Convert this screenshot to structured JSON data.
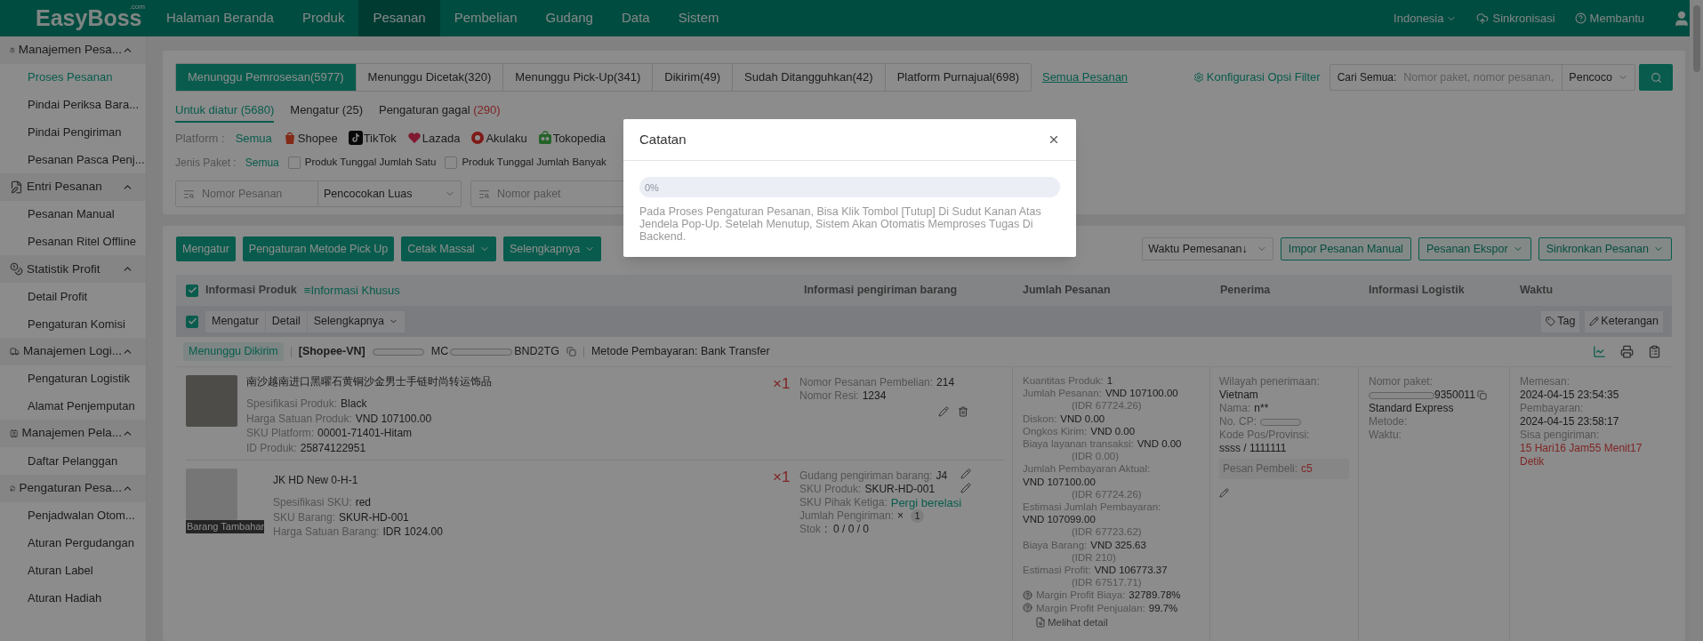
{
  "top_nav": {
    "logo": "EasyBoss",
    "logo_suffix": ".com",
    "menu": [
      {
        "label": "Halaman Beranda",
        "selected": false
      },
      {
        "label": "Produk",
        "selected": false
      },
      {
        "label": "Pesanan",
        "selected": true
      },
      {
        "label": "Pembelian",
        "selected": false
      },
      {
        "label": "Gudang",
        "selected": false
      },
      {
        "label": "Data",
        "selected": false
      },
      {
        "label": "Sistem",
        "selected": false
      }
    ],
    "language": "Indonesia",
    "sync": "Sinkronisasi",
    "help": "Membantu"
  },
  "sidebar": {
    "groups": [
      {
        "label": "Manajemen Pesa...",
        "expanded": true,
        "items": [
          {
            "label": "Proses Pesanan",
            "selected": true
          },
          {
            "label": "Pindai Periksa Bara...",
            "selected": false
          },
          {
            "label": "Pindai Pengiriman",
            "selected": false
          },
          {
            "label": "Pesanan Pasca Penj...",
            "selected": false
          }
        ]
      },
      {
        "label": "Entri Pesanan",
        "expanded": true,
        "items": [
          {
            "label": "Pesanan Manual",
            "selected": false
          },
          {
            "label": "Pesanan Ritel Offline",
            "selected": false
          }
        ]
      },
      {
        "label": "Statistik Profit",
        "expanded": true,
        "items": [
          {
            "label": "Detail Profit",
            "selected": false
          },
          {
            "label": "Pengaturan Komisi",
            "selected": false
          }
        ]
      },
      {
        "label": "Manajemen Logi...",
        "expanded": true,
        "items": [
          {
            "label": "Pengaturan Logistik",
            "selected": false
          },
          {
            "label": "Alamat Penjemputan",
            "selected": false
          }
        ]
      },
      {
        "label": "Manajemen Pela...",
        "expanded": true,
        "items": [
          {
            "label": "Daftar Pelanggan",
            "selected": false
          }
        ]
      },
      {
        "label": "Pengaturan Pesa...",
        "expanded": true,
        "items": [
          {
            "label": "Penjadwalan Otom...",
            "selected": false
          },
          {
            "label": "Aturan Pergudangan",
            "selected": false
          },
          {
            "label": "Aturan Label",
            "selected": false
          },
          {
            "label": "Aturan Hadiah",
            "selected": false
          }
        ]
      }
    ]
  },
  "filter_panel": {
    "status_tabs": [
      {
        "label": "Menunggu Pemrosesan(5977)",
        "selected": true
      },
      {
        "label": "Menunggu Dicetak(320)",
        "selected": false
      },
      {
        "label": "Menunggu Pick-Up(341)",
        "selected": false
      },
      {
        "label": "Dikirim(49)",
        "selected": false
      },
      {
        "label": "Sudah Ditangguhkan(42)",
        "selected": false
      },
      {
        "label": "Platform Purnajual(698)",
        "selected": false
      }
    ],
    "all_orders_link": "Semua Pesanan",
    "filter_config": "Konfigurasi Opsi Filter",
    "search": {
      "label": "Cari Semua:",
      "placeholder": "Nomor paket, nomor pesanan,",
      "match": "Pencoco"
    },
    "sub_tabs": [
      {
        "label": "Untuk diatur",
        "count": "(5680)",
        "selected": true,
        "alert": false
      },
      {
        "label": "Mengatur",
        "count": "(25)",
        "selected": false,
        "alert": false
      },
      {
        "label": "Pengaturan gagal",
        "count": "(290)",
        "selected": false,
        "alert": true
      }
    ],
    "platform": {
      "label": "Platform :",
      "options": [
        {
          "label": "Semua",
          "selected": true
        },
        {
          "label": "Shopee",
          "selected": false
        },
        {
          "label": "TikTok",
          "selected": false
        },
        {
          "label": "Lazada",
          "selected": false
        },
        {
          "label": "Akulaku",
          "selected": false
        },
        {
          "label": "Tokopedia",
          "selected": false
        }
      ]
    },
    "package_type": {
      "label": "Jenis Paket :",
      "all": {
        "label": "Semua",
        "selected": true
      },
      "checkboxes": [
        {
          "label": "Produk Tunggal Jumlah Satu",
          "checked": false
        },
        {
          "label": "Produk Tunggal Jumlah Banyak",
          "checked": false
        }
      ]
    },
    "fields": [
      {
        "placeholder": "Nomor Pesanan",
        "match": "Pencocokan Luas"
      },
      {
        "placeholder": "Nomor paket"
      }
    ]
  },
  "orders_panel": {
    "actions": [
      {
        "label": "Mengatur",
        "dropdown": false
      },
      {
        "label": "Pengaturan Metode Pick Up",
        "dropdown": false
      },
      {
        "label": "Cetak Massal",
        "dropdown": true
      },
      {
        "label": "Selengkapnya",
        "dropdown": true
      }
    ],
    "sort": "Waktu Pemesanan↓",
    "right_actions": [
      {
        "label": "Impor Pesanan Manual",
        "dropdown": false
      },
      {
        "label": "Pesanan Ekspor",
        "dropdown": true
      },
      {
        "label": "Sinkronkan Pesanan",
        "dropdown": true
      }
    ],
    "table": {
      "select_all_checked": true,
      "special_info": "≡Informasi Khusus",
      "columns": [
        "Informasi Produk",
        "Informasi pengiriman barang",
        "Jumlah Pesanan",
        "Penerima",
        "Informasi Logistik",
        "Waktu"
      ],
      "bulk_bar": {
        "checked": true,
        "buttons": [
          {
            "label": "Mengatur",
            "dropdown": false
          },
          {
            "label": "Detail",
            "dropdown": false
          },
          {
            "label": "Selengkapnya",
            "dropdown": true
          }
        ],
        "tag": "Tag",
        "note": "Keterangan"
      },
      "order": {
        "status": "Menunggu Dikirim",
        "store": "[Shopee-VN]",
        "order_no_start": "MC",
        "order_no_end": "BND2TG",
        "payment": "Metode Pembayaran: Bank Transfer",
        "items": [
          {
            "kind": "product",
            "title": "南沙越南进口黑曜石黄铜沙金男士手链时尚转运饰品",
            "quantity": "×1",
            "details": [
              {
                "label": "Spesifikasi Produk:",
                "value": "Black"
              },
              {
                "label": "Harga Satuan Produk:",
                "value": "VND 107100.00"
              },
              {
                "label": "SKU Platform:",
                "value": "00001-71401-Hitam"
              },
              {
                "label": "ID Produk:",
                "value": "25874122951"
              }
            ],
            "shipping": [
              {
                "kind": "text",
                "label": "Nomor Pesanan Pembelian:",
                "value": "214"
              },
              {
                "kind": "text",
                "label": "Nomor Resi:",
                "value": "1234"
              }
            ]
          },
          {
            "kind": "gift",
            "caption": "Barang Tambahan",
            "title": "JK HD New 0-H-1",
            "quantity": "×1",
            "details": [
              {
                "label": "Spesifikasi SKU:",
                "value": "red"
              },
              {
                "label": "SKU Barang:",
                "value": "SKUR-HD-001"
              },
              {
                "label": "Harga Satuan Barang:",
                "value": "IDR 1024.00"
              }
            ],
            "shipping": [
              {
                "kind": "text",
                "label": "Gudang pengiriman barang:",
                "value": "J4"
              },
              {
                "kind": "text",
                "label": "SKU Produk:",
                "value": "SKUR-HD-001"
              },
              {
                "kind": "link",
                "label": "SKU Pihak Ketiga:",
                "value": "Pergi berelasi"
              },
              {
                "kind": "count",
                "label": "Jumlah Pengiriman:",
                "value": "×",
                "badge": "1"
              },
              {
                "kind": "text",
                "label": "Stok",
                "value": ":  0 / 0 / 0"
              }
            ]
          }
        ],
        "amounts": [
          {
            "kind": "amount",
            "label": "Kuantitas Produk:",
            "value": "1"
          },
          {
            "kind": "amount",
            "label": "Jumlah Pesanan:",
            "value": "VND 107100.00",
            "sub": "(IDR 67724.26)"
          },
          {
            "kind": "amount",
            "label": "Diskon:",
            "value": "VND 0.00"
          },
          {
            "kind": "amount",
            "label": "Ongkos Kirim:",
            "value": "VND 0.00"
          },
          {
            "kind": "amount",
            "label": "Biaya layanan transaksi:",
            "value": "VND 0.00",
            "sub": "(IDR 0.00)"
          },
          {
            "kind": "amount",
            "label": "Jumlah Pembayaran Aktual:",
            "value": "VND 107100.00",
            "sub": "(IDR 67724.26)"
          },
          {
            "kind": "amount",
            "label": "Estimasi Jumlah Pembayaran:",
            "value": "VND 107099.00",
            "sub": "(IDR 67723.62)"
          },
          {
            "kind": "amount",
            "label": "Biaya Barang:",
            "value": "VND 325.63",
            "sub": "(IDR 210)"
          },
          {
            "kind": "amount",
            "label": "Estimasi Profit:",
            "value": "VND 106773.37",
            "sub": "(IDR 67517.71)"
          },
          {
            "kind": "margin",
            "label": "Margin Profit Biaya:",
            "value": "32789.78%"
          },
          {
            "kind": "margin",
            "label": "Margin Profit Penjualan:",
            "value": "99.7%"
          }
        ],
        "detail_link": "Melihat detail",
        "recipient": {
          "region_label": "Wilayah penerimaan:",
          "region": "Vietnam",
          "name_label": "Nama:",
          "name": "n**",
          "phone_label": "No. CP:",
          "postal_label": "Kode Pos/Provinsi:",
          "postal": "ssss / 1111111",
          "message_label": "Pesan Pembeli:",
          "message": "c5"
        },
        "logistics": {
          "package_label": "Nomor paket:",
          "package_tail": "9350011",
          "carrier": "Standard Express",
          "method_label": "Metode:",
          "time_label": "Waktu:"
        },
        "time": {
          "ordered_label": "Memesan:",
          "ordered": "2024-04-15 23:54:35",
          "paid_label": "Pembayaran:",
          "paid": "2024-04-15 23:58:17",
          "remaining_label": "Sisa pengiriman:",
          "remaining": "15 Hari16 Jam55 Menit17 Detik"
        }
      }
    }
  },
  "modal": {
    "title": "Catatan",
    "level": 0,
    "progress_text": "0%",
    "message": "Pada Proses Pengaturan Pesanan, Bisa Klik Tombol [Tutup] Di Sudut Kanan Atas Jendela Pop-Up. Setelah Menutup, Sistem Akan Otomatis Memproses Tugas Di Backend."
  }
}
